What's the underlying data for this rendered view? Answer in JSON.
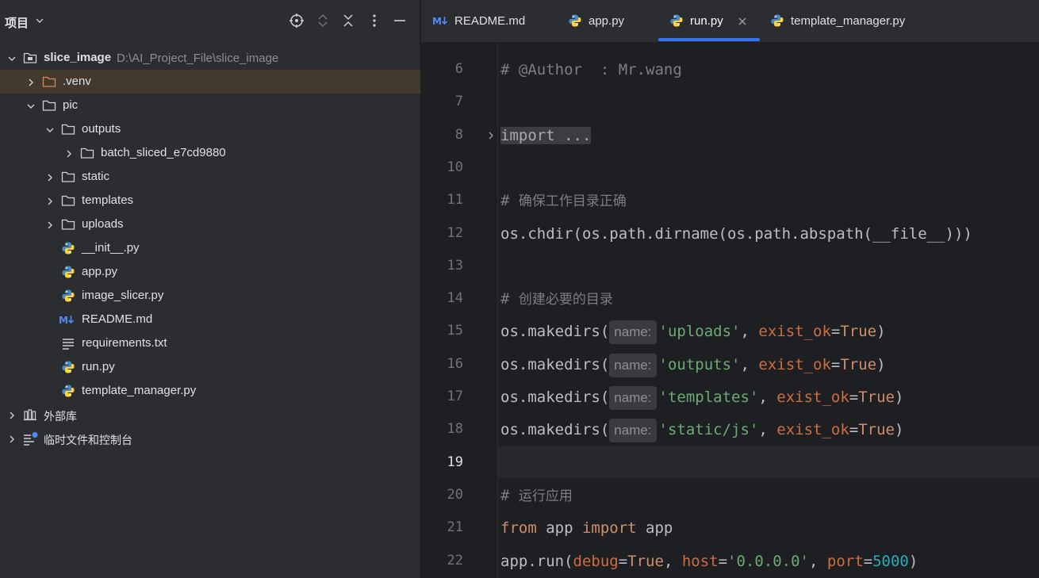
{
  "project_panel": {
    "title": "项目",
    "tree": [
      {
        "label": "slice_image",
        "path": "D:\\AI_Project_File\\slice_image",
        "level": 0,
        "chevron": "down",
        "icon": "module-folder-icon"
      },
      {
        "label": ".venv",
        "level": 1,
        "chevron": "right",
        "icon": "excluded-folder-icon",
        "selected": true
      },
      {
        "label": "pic",
        "level": 1,
        "chevron": "down",
        "icon": "folder-icon"
      },
      {
        "label": "outputs",
        "level": 2,
        "chevron": "down",
        "icon": "folder-icon"
      },
      {
        "label": "batch_sliced_e7cd9880",
        "level": 3,
        "chevron": "right",
        "icon": "folder-icon"
      },
      {
        "label": "static",
        "level": 2,
        "chevron": "right",
        "icon": "folder-icon"
      },
      {
        "label": "templates",
        "level": 2,
        "chevron": "right",
        "icon": "folder-icon"
      },
      {
        "label": "uploads",
        "level": 2,
        "chevron": "right",
        "icon": "folder-icon"
      },
      {
        "label": "__init__.py",
        "level": 2,
        "icon": "python-file-icon"
      },
      {
        "label": "app.py",
        "level": 2,
        "icon": "python-file-icon"
      },
      {
        "label": "image_slicer.py",
        "level": 2,
        "icon": "python-file-icon"
      },
      {
        "label": "README.md",
        "level": 2,
        "icon": "markdown-file-icon"
      },
      {
        "label": "requirements.txt",
        "level": 2,
        "icon": "text-file-icon"
      },
      {
        "label": "run.py",
        "level": 2,
        "icon": "python-file-icon"
      },
      {
        "label": "template_manager.py",
        "level": 2,
        "icon": "python-file-icon"
      },
      {
        "label": "外部库",
        "level": 0,
        "chevron": "right",
        "icon": "library-icon"
      },
      {
        "label": "临时文件和控制台",
        "level": 0,
        "chevron": "right",
        "icon": "scratches-icon"
      }
    ]
  },
  "tabs": [
    {
      "label": "README.md",
      "icon": "markdown-file-icon",
      "active": false
    },
    {
      "label": "app.py",
      "icon": "python-file-icon",
      "active": false
    },
    {
      "label": "run.py",
      "icon": "python-file-icon",
      "active": true
    },
    {
      "label": "template_manager.py",
      "icon": "python-file-icon",
      "active": false
    }
  ],
  "editor": {
    "current_line": "19",
    "lines": [
      {
        "n": "6",
        "code": [
          [
            "cm",
            "# @Author  : Mr.wang"
          ]
        ]
      },
      {
        "n": "7",
        "code": []
      },
      {
        "n": "8",
        "code": [
          [
            "fold",
            "import ..."
          ]
        ],
        "folded": true
      },
      {
        "n": "10",
        "code": []
      },
      {
        "n": "11",
        "code": [
          [
            "cm",
            "# "
          ],
          [
            "cmcjk",
            "确保工作目录正确"
          ]
        ]
      },
      {
        "n": "12",
        "code": [
          [
            "plain",
            "os.chdir(os.path.dirname(os.path.abspath(__file__)))"
          ]
        ]
      },
      {
        "n": "13",
        "code": []
      },
      {
        "n": "14",
        "code": [
          [
            "cm",
            "# "
          ],
          [
            "cmcjk",
            "创建必要的目录"
          ]
        ]
      },
      {
        "n": "15",
        "code": [
          [
            "plain",
            "os.makedirs("
          ],
          [
            "hint",
            "name:"
          ],
          [
            "str",
            "'uploads'"
          ],
          [
            "plain",
            ", "
          ],
          [
            "param2",
            "exist_ok"
          ],
          [
            "plain",
            "="
          ],
          [
            "kw",
            "True"
          ],
          [
            "plain",
            ")"
          ]
        ]
      },
      {
        "n": "16",
        "code": [
          [
            "plain",
            "os.makedirs("
          ],
          [
            "hint",
            "name:"
          ],
          [
            "str",
            "'outputs'"
          ],
          [
            "plain",
            ", "
          ],
          [
            "param2",
            "exist_ok"
          ],
          [
            "plain",
            "="
          ],
          [
            "kw",
            "True"
          ],
          [
            "plain",
            ")"
          ]
        ]
      },
      {
        "n": "17",
        "code": [
          [
            "plain",
            "os.makedirs("
          ],
          [
            "hint",
            "name:"
          ],
          [
            "str",
            "'templates'"
          ],
          [
            "plain",
            ", "
          ],
          [
            "param2",
            "exist_ok"
          ],
          [
            "plain",
            "="
          ],
          [
            "kw",
            "True"
          ],
          [
            "plain",
            ")"
          ]
        ]
      },
      {
        "n": "18",
        "code": [
          [
            "plain",
            "os.makedirs("
          ],
          [
            "hint",
            "name:"
          ],
          [
            "str",
            "'static/js'"
          ],
          [
            "plain",
            ", "
          ],
          [
            "param2",
            "exist_ok"
          ],
          [
            "plain",
            "="
          ],
          [
            "kw",
            "True"
          ],
          [
            "plain",
            ")"
          ]
        ]
      },
      {
        "n": "19",
        "code": []
      },
      {
        "n": "20",
        "code": [
          [
            "cm",
            "# "
          ],
          [
            "cmcjk",
            "运行应用"
          ]
        ]
      },
      {
        "n": "21",
        "code": [
          [
            "kw",
            "from"
          ],
          [
            "plain",
            " app "
          ],
          [
            "kw",
            "import"
          ],
          [
            "plain",
            " app"
          ]
        ]
      },
      {
        "n": "22",
        "code": [
          [
            "plain",
            "app.run("
          ],
          [
            "param2",
            "debug"
          ],
          [
            "plain",
            "="
          ],
          [
            "kw",
            "True"
          ],
          [
            "plain",
            ", "
          ],
          [
            "param2",
            "host"
          ],
          [
            "plain",
            "="
          ],
          [
            "str",
            "'0.0.0.0'"
          ],
          [
            "plain",
            ", "
          ],
          [
            "param2",
            "port"
          ],
          [
            "plain",
            "="
          ],
          [
            "num",
            "5000"
          ],
          [
            "plain",
            ")"
          ]
        ]
      }
    ]
  },
  "colors": {
    "keyword": "#cf8e6d",
    "string": "#6aab73",
    "number": "#2aacb8",
    "comment": "#7a7e85",
    "named_param": "#cc6e3f",
    "accent": "#3574f0",
    "selected_row": "#43392c"
  }
}
